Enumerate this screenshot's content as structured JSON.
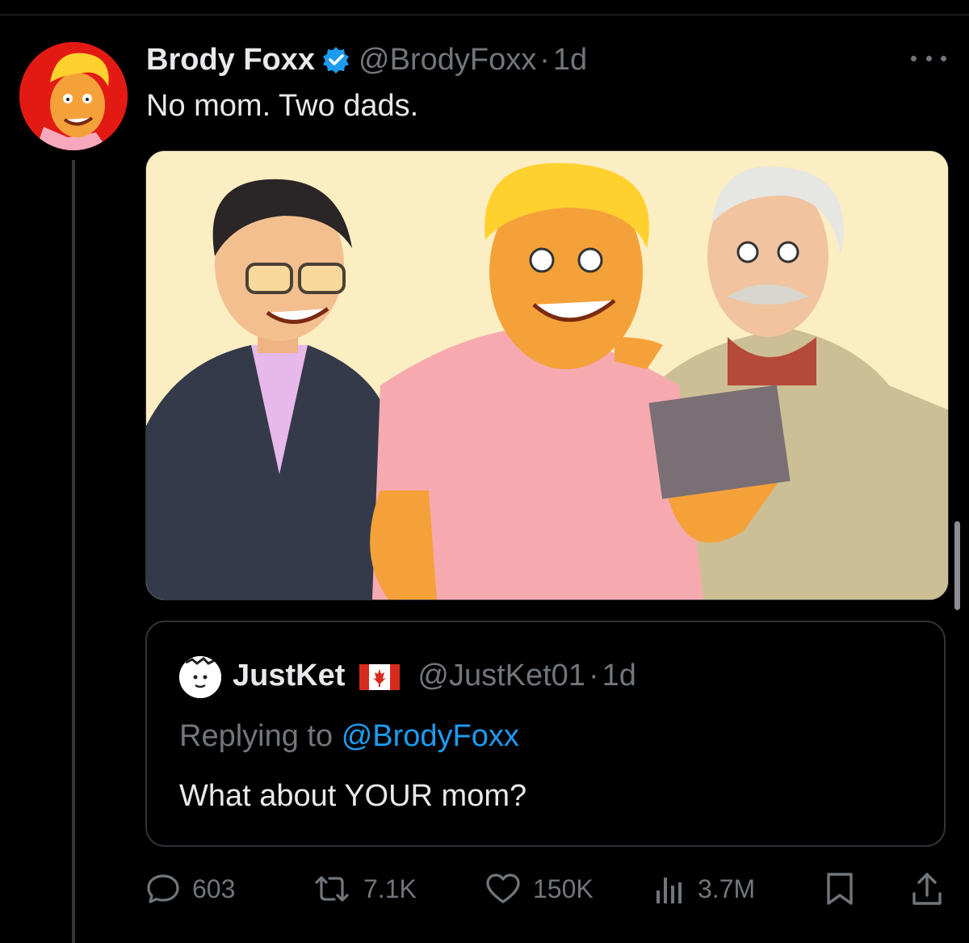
{
  "tweet": {
    "display_name": "Brody Foxx",
    "handle": "@BrodyFoxx",
    "separator": "·",
    "time": "1d",
    "text": "No mom. Two dads."
  },
  "quote": {
    "display_name": "JustKet",
    "handle": "@JustKet01",
    "separator": "·",
    "time": "1d",
    "replying_prefix": "Replying to",
    "replying_mention": "@BrodyFoxx",
    "text": "What about YOUR mom?"
  },
  "actions": {
    "replies": "603",
    "reposts": "7.1K",
    "likes": "150K",
    "views": "3.7M"
  },
  "icons": {
    "verified": "verified-badge-icon",
    "flag": "canada-flag-icon",
    "reply": "reply-bubble-icon",
    "repost": "repost-arrows-icon",
    "like": "heart-icon",
    "views": "views-bars-icon",
    "bookmark": "bookmark-icon",
    "share": "share-upload-icon"
  },
  "colors": {
    "background": "#000000",
    "text": "#e7e9ea",
    "muted": "#71767b",
    "accent": "#1d9bf0",
    "border": "#2f3336"
  }
}
